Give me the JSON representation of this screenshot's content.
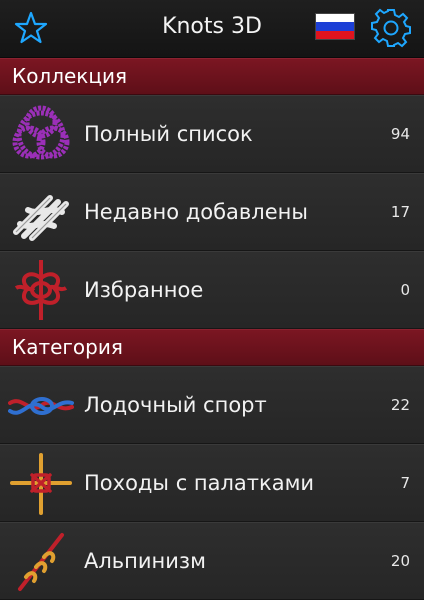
{
  "header": {
    "title": "Knots 3D",
    "flag_colors": [
      "#ffffff",
      "#1c3fd6",
      "#e0141e"
    ],
    "accent": "#1ea7ff"
  },
  "sections": {
    "collection": {
      "title": "Коллекция",
      "items": [
        {
          "label": "Полный список",
          "count": "94",
          "icon": "celtic-knot-icon"
        },
        {
          "label": "Недавно добавлены",
          "count": "17",
          "icon": "braided-knot-icon"
        },
        {
          "label": "Избранное",
          "count": "0",
          "icon": "decorative-knot-icon"
        }
      ]
    },
    "category": {
      "title": "Категория",
      "items": [
        {
          "label": "Лодочный спорт",
          "count": "22",
          "icon": "boating-knot-icon"
        },
        {
          "label": "Походы с палатками",
          "count": "7",
          "icon": "camping-knot-icon"
        },
        {
          "label": "Альпинизм",
          "count": "20",
          "icon": "climbing-knot-icon"
        }
      ]
    }
  }
}
